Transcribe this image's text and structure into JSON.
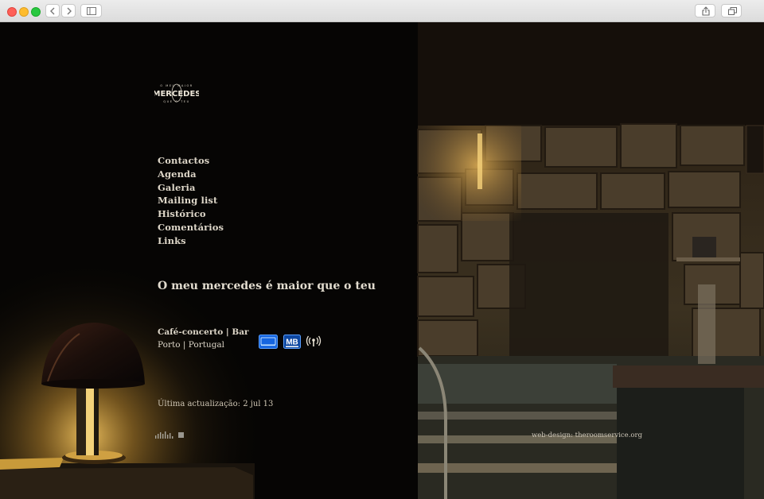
{
  "brand": {
    "logo_text": "MERCEDES",
    "logo_top_text": "O MEU MAIOR",
    "logo_bottom_text": "QUE O TEU"
  },
  "menu": {
    "items": [
      {
        "label": "Contactos"
      },
      {
        "label": "Agenda"
      },
      {
        "label": "Galeria"
      },
      {
        "label": "Mailing list"
      },
      {
        "label": "Histórico"
      },
      {
        "label": "Comentários"
      },
      {
        "label": "Links"
      }
    ]
  },
  "slogan": "O meu mercedes é maior que o teu",
  "venue": {
    "type": "Café-concerto | Bar",
    "location": "Porto | Portugal"
  },
  "payment_icons": [
    {
      "name": "card-icon"
    },
    {
      "name": "multibanco-icon",
      "label": "MB"
    },
    {
      "name": "wifi-icon"
    }
  ],
  "last_update": "Última actualização: 2 jul 13",
  "credit": "web-design: theroomservice.org",
  "colors": {
    "background": "#050404",
    "text": "#ddd6c8",
    "icon_blue": "#1565e0",
    "lamp_glow": "#f5c04a"
  }
}
